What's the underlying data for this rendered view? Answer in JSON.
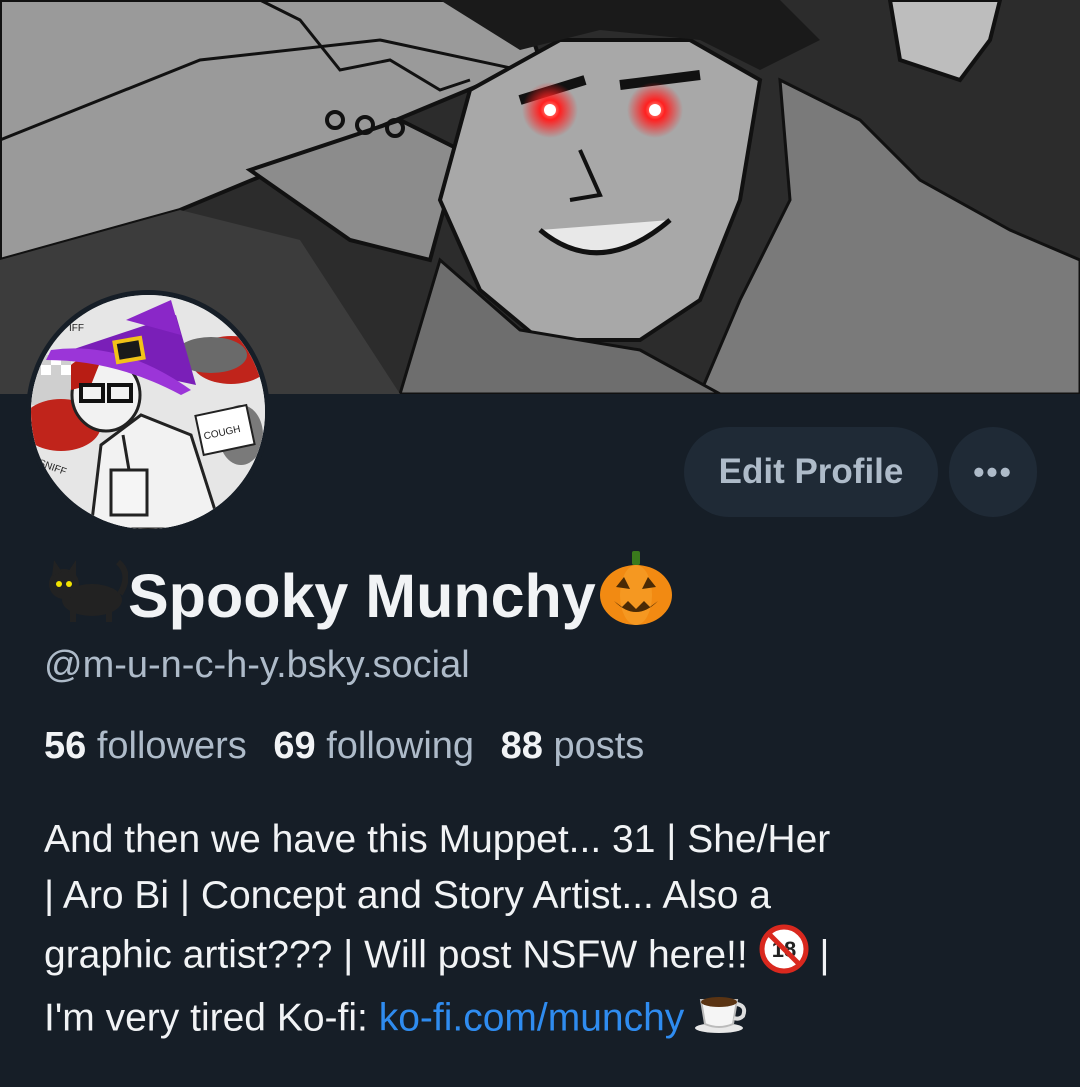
{
  "profile": {
    "display_name": "Spooky Munchy",
    "handle": "@m-u-n-c-h-y.bsky.social",
    "name_prefix_icon": "black-cat-icon",
    "name_suffix_icon": "jack-o-lantern-icon"
  },
  "actions": {
    "edit_label": "Edit Profile",
    "more_label": "•••"
  },
  "stats": {
    "followers_count": "56",
    "followers_label": "followers",
    "following_count": "69",
    "following_label": "following",
    "posts_count": "88",
    "posts_label": "posts"
  },
  "bio": {
    "line1": "And then we have this Muppet... 31 | She/Her",
    "line2": "| Aro Bi | Concept and Story Artist... Also a",
    "line3": "graphic artist??? | Will post NSFW here!! ",
    "line3_icon": "no-under-18-icon",
    "line3_end": " |",
    "line4_prefix": "I'm very tired Ko-fi: ",
    "link_text": "ko-fi.com/munchy",
    "line4_icon": "coffee-icon"
  },
  "avatar": {
    "text_cough": "COUGH",
    "text_sniff": "SNIFF",
    "text_iff": "IFF"
  },
  "colors": {
    "background": "#161e27",
    "button_bg": "#1f2a36",
    "muted_text": "#aebbc9",
    "link": "#2f8cf0",
    "eye_glow": "#ff2020"
  }
}
